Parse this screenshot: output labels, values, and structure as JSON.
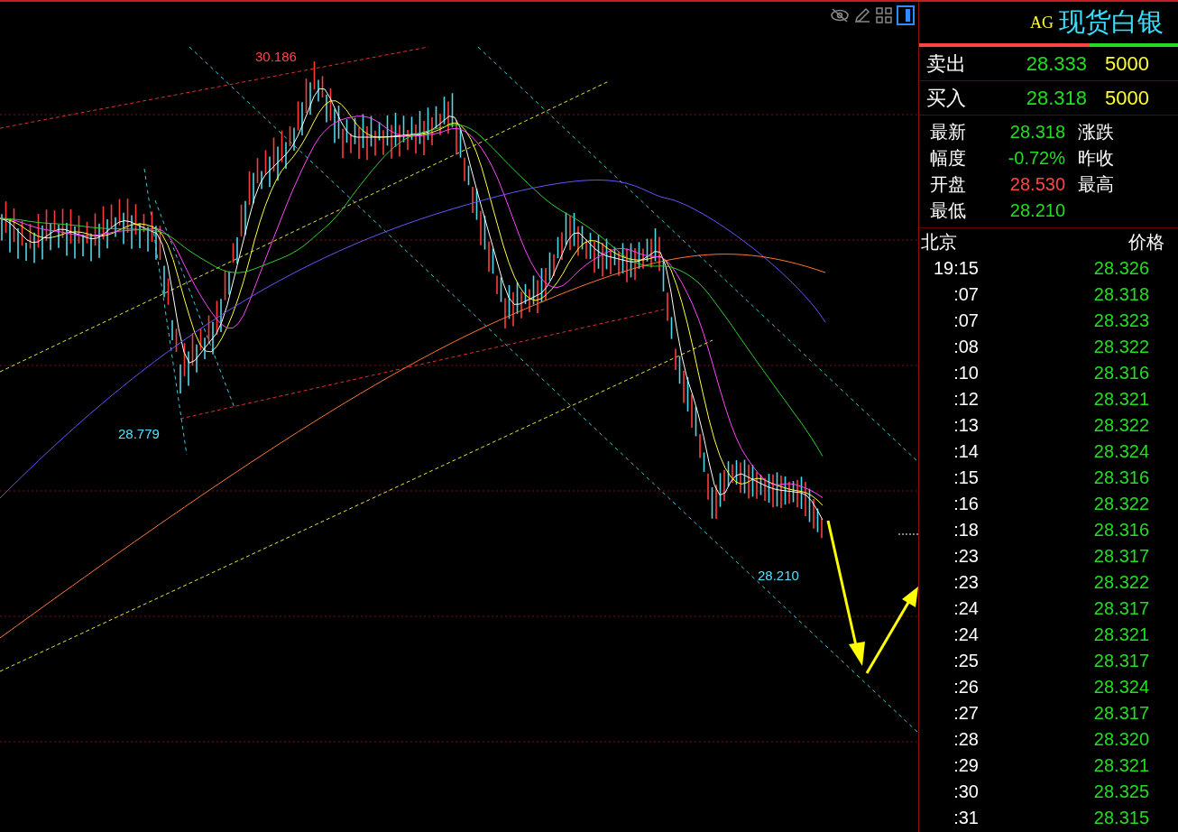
{
  "chart": {
    "annotations": [
      {
        "text": "30.186",
        "kind": "high"
      },
      {
        "text": "28.779",
        "kind": "low"
      },
      {
        "text": "28.210",
        "kind": "low"
      }
    ]
  },
  "quote": {
    "code": "AG",
    "title": "现货白银",
    "strength_bar": {
      "level": 0.66
    },
    "bid_ask": [
      {
        "label": "卖出",
        "price": "28.333",
        "volume": "5000"
      },
      {
        "label": "买入",
        "price": "28.318",
        "volume": "5000"
      }
    ],
    "stats": [
      {
        "label": "最新",
        "value": "28.318",
        "color": "#22dd22"
      },
      {
        "label": "涨跌"
      },
      {
        "label": "幅度",
        "value": "-0.72%",
        "color": "#22dd22"
      },
      {
        "label": "昨收"
      },
      {
        "label": "开盘",
        "value": "28.530",
        "color": "#ff4444"
      },
      {
        "label": "最高"
      },
      {
        "label": "最低",
        "value": "28.210",
        "color": "#22dd22"
      }
    ]
  },
  "ticks": {
    "columns": [
      "北京",
      "价格"
    ],
    "rows": [
      {
        "time": "19:15",
        "price": "28.326"
      },
      {
        "time": ":07",
        "price": "28.318"
      },
      {
        "time": ":07",
        "price": "28.323"
      },
      {
        "time": ":08",
        "price": "28.322"
      },
      {
        "time": ":10",
        "price": "28.316"
      },
      {
        "time": ":12",
        "price": "28.321"
      },
      {
        "time": ":13",
        "price": "28.322"
      },
      {
        "time": ":14",
        "price": "28.324"
      },
      {
        "time": ":15",
        "price": "28.316"
      },
      {
        "time": ":16",
        "price": "28.322"
      },
      {
        "time": ":18",
        "price": "28.316"
      },
      {
        "time": ":23",
        "price": "28.317"
      },
      {
        "time": ":23",
        "price": "28.322"
      },
      {
        "time": ":24",
        "price": "28.317"
      },
      {
        "time": ":24",
        "price": "28.321"
      },
      {
        "time": ":25",
        "price": "28.317"
      },
      {
        "time": ":26",
        "price": "28.324"
      },
      {
        "time": ":27",
        "price": "28.317"
      },
      {
        "time": ":28",
        "price": "28.320"
      },
      {
        "time": ":29",
        "price": "28.321"
      },
      {
        "time": ":30",
        "price": "28.325"
      },
      {
        "time": ":31",
        "price": "28.315"
      }
    ]
  }
}
